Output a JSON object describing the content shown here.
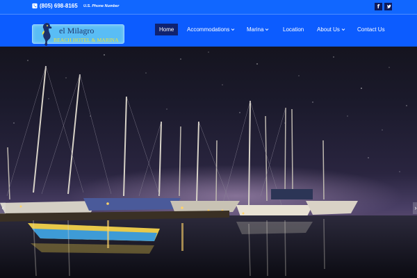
{
  "topbar": {
    "phone": "(805) 698-8165",
    "phone_note": "U.S. Phone Number",
    "social": [
      {
        "name": "facebook",
        "glyph": "f"
      },
      {
        "name": "twitter",
        "glyph": "t"
      }
    ]
  },
  "logo": {
    "name": "el Milagro",
    "subtitle": "BEACH HOTEL & MARINA"
  },
  "nav": {
    "items": [
      {
        "label": "Home",
        "active": true,
        "dropdown": false
      },
      {
        "label": "Accommodations",
        "active": false,
        "dropdown": true
      },
      {
        "label": "Marina",
        "active": false,
        "dropdown": true
      },
      {
        "label": "Location",
        "active": false,
        "dropdown": false
      },
      {
        "label": "About Us",
        "active": false,
        "dropdown": true
      },
      {
        "label": "Contact Us",
        "active": false,
        "dropdown": false
      }
    ]
  },
  "hero": {
    "image": "night marina with sailboats under starry sky",
    "prev_glyph": "‹",
    "next_glyph": "›"
  },
  "colors": {
    "topbar": "#1167ff",
    "header": "#0c5cff",
    "active_nav": "#102270"
  }
}
